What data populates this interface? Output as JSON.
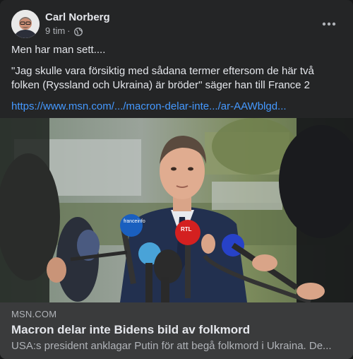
{
  "post": {
    "author": "Carl Norberg",
    "time": "9 tim",
    "separator": "·",
    "privacy_icon": "globe-icon",
    "more_icon": "more-options-icon",
    "lines": [
      "Men har man sett....",
      "\"Jag skulle vara försiktig med sådana termer eftersom de här två folken (Ryssland och Ukraina) är bröder\" säger han till France 2"
    ],
    "link": "https://www.msn.com/.../macron-delar-inte.../ar-AAWblgd..."
  },
  "preview": {
    "domain": "MSN.COM",
    "title": "Macron delar inte Bidens bild av folkmord",
    "description": "USA:s president anklagar Putin för att begå folkmord i Ukraina. De..."
  },
  "microphones": [
    {
      "label": "franceinfo"
    },
    {
      "label": "RTL"
    }
  ],
  "colors": {
    "card_bg": "#242526",
    "preview_bg": "#3a3b3c",
    "link": "#4599ff",
    "text_primary": "#e4e6eb",
    "text_secondary": "#b0b3b8"
  }
}
